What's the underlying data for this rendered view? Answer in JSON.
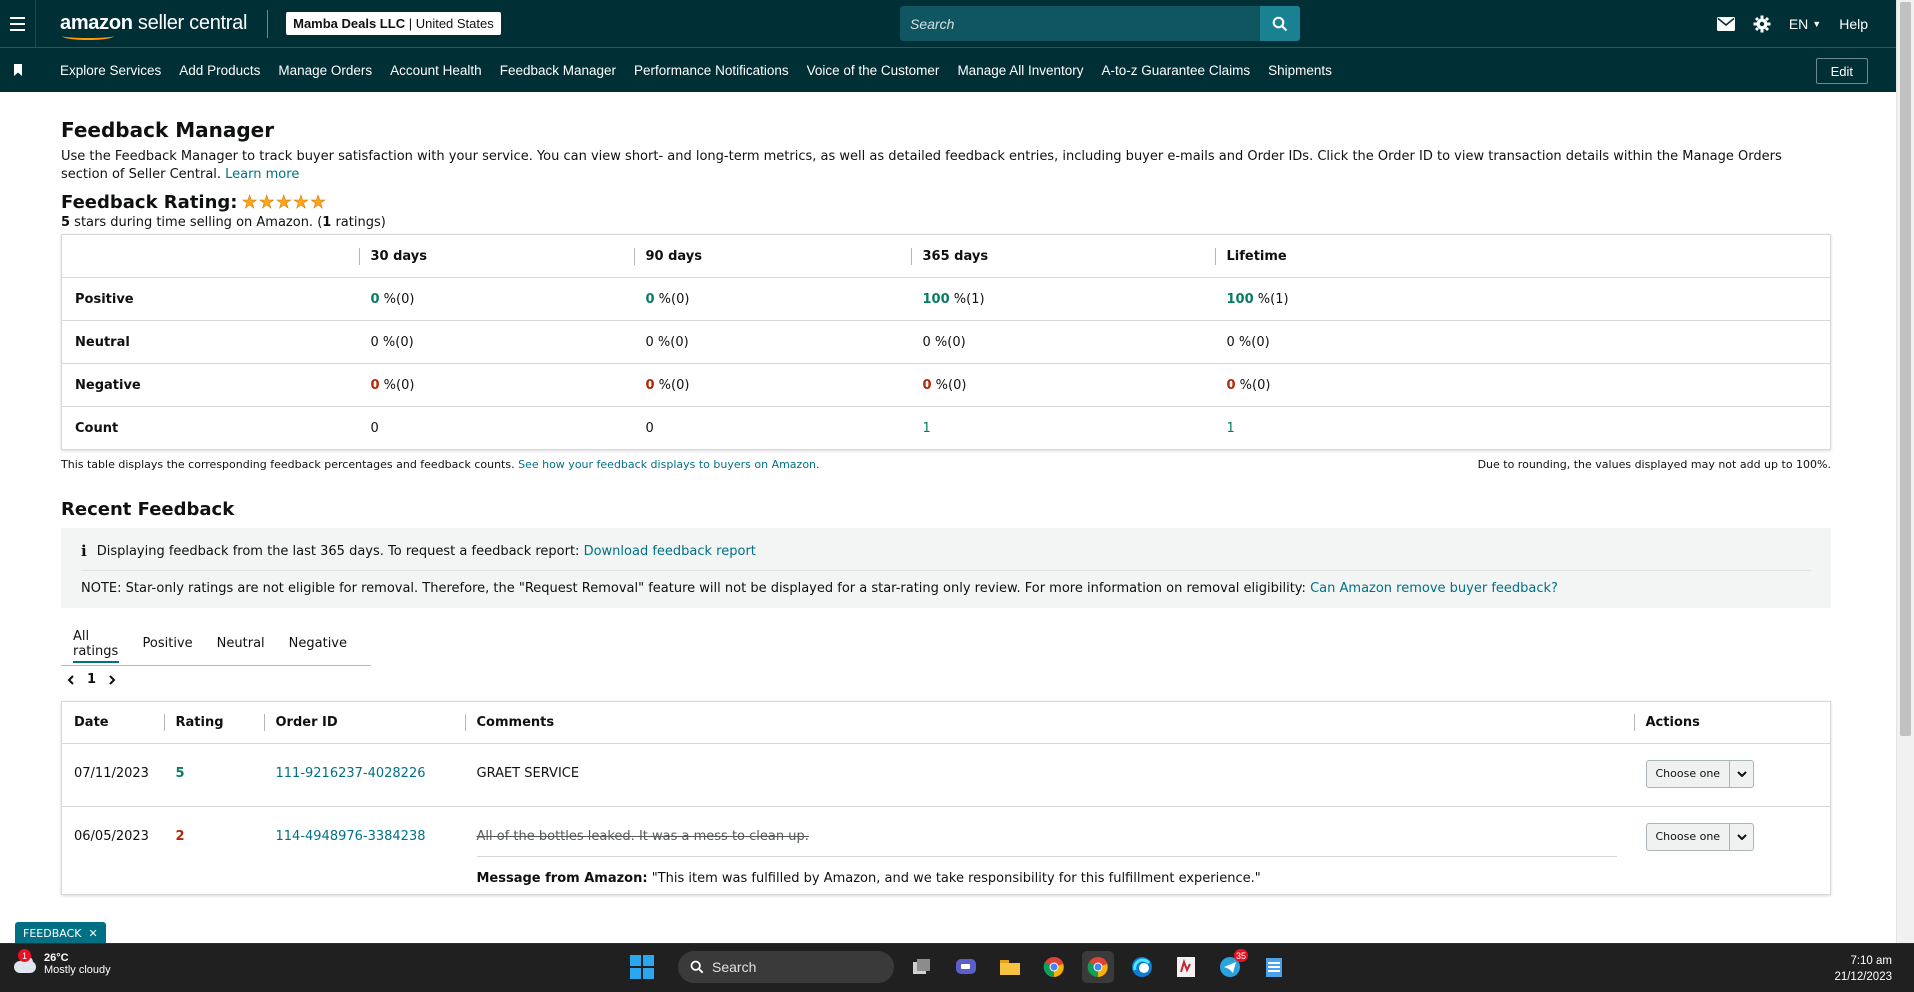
{
  "header": {
    "logo_text_bold": "amazon",
    "logo_text": " seller central",
    "account_name": "Mamba Deals LLC",
    "account_region": " | United States",
    "search_placeholder": "Search",
    "language": "EN",
    "help": "Help"
  },
  "nav": {
    "items": [
      "Explore Services",
      "Add Products",
      "Manage Orders",
      "Account Health",
      "Feedback Manager",
      "Performance Notifications",
      "Voice of the Customer",
      "Manage All Inventory",
      "A-to-z Guarantee Claims",
      "Shipments"
    ],
    "edit_label": "Edit"
  },
  "page": {
    "title": "Feedback Manager",
    "intro": "Use the Feedback Manager to track buyer satisfaction with your service. You can view short- and long-term metrics, as well as detailed feedback entries, including buyer e-mails and Order IDs. Click the Order ID to view transaction details within the Manage Orders section of Seller Central.",
    "learn_more": "Learn more",
    "rating_title": "Feedback Rating:",
    "rating_stars": 5,
    "rating_sub_prefix": "5",
    "rating_sub_middle": " stars during time selling on Amazon. (",
    "rating_sub_count": "1",
    "rating_sub_suffix": " ratings)"
  },
  "summary": {
    "columns": [
      "30 days",
      "90 days",
      "365 days",
      "Lifetime"
    ],
    "rows": {
      "positive": {
        "label": "Positive",
        "cells": [
          [
            "0",
            " %(0)"
          ],
          [
            "0",
            " %(0)"
          ],
          [
            "100",
            " %(1)"
          ],
          [
            "100",
            " %(1)"
          ]
        ]
      },
      "neutral": {
        "label": "Neutral",
        "cells": [
          "0 %(0)",
          "0 %(0)",
          "0 %(0)",
          "0 %(0)"
        ]
      },
      "negative": {
        "label": "Negative",
        "cells": [
          [
            "0",
            " %(0)"
          ],
          [
            "0",
            " %(0)"
          ],
          [
            "0",
            " %(0)"
          ],
          [
            "0",
            " %(0)"
          ]
        ]
      },
      "count": {
        "label": "Count",
        "cells": [
          "0",
          "0",
          "1",
          "1"
        ]
      }
    },
    "note_left": "This table displays the corresponding feedback percentages and feedback counts.",
    "note_link": "See how your feedback displays to buyers on Amazon.",
    "note_right": "Due to rounding, the values displayed may not add up to 100%."
  },
  "recent": {
    "title": "Recent Feedback",
    "info_text": "Displaying feedback from the last 365 days. To request a feedback report:",
    "info_link": "Download feedback report",
    "note_text": "NOTE: Star-only ratings are not eligible for removal. Therefore, the \"Request Removal\" feature will not be displayed for a star-rating only review. For more information on removal eligibility:",
    "note_link": "Can Amazon remove buyer feedback?",
    "tabs": [
      "All ratings",
      "Positive",
      "Neutral",
      "Negative"
    ],
    "page_number": "1",
    "columns": [
      "Date",
      "Rating",
      "Order ID",
      "Comments",
      "Actions"
    ],
    "rows": [
      {
        "date": "07/11/2023",
        "rating": "5",
        "order_id": "111-9216237-4028226",
        "comment": "GRAET SERVICE",
        "action": "Choose one"
      },
      {
        "date": "06/05/2023",
        "rating": "2",
        "order_id": "114-4948976-3384238",
        "comment": "All of the bottles leaked. It was a mess to clean up.",
        "amazon_msg_label": "Message from Amazon:",
        "amazon_msg": " \"This item was fulfilled by Amazon, and we take responsibility for this fulfillment experience.\"",
        "action": "Choose one"
      }
    ]
  },
  "feedback_tab": "FEEDBACK",
  "taskbar": {
    "weather_temp": "26°C",
    "weather_desc": "Mostly cloudy",
    "weather_badge": "1",
    "search": "Search",
    "telegram_badge": "35",
    "time": "7:10 am",
    "date": "21/12/2023"
  },
  "colors": {
    "header_bg": "#002f36",
    "link": "#007185",
    "positive": "#067d62",
    "negative": "#b12704",
    "star": "#ffa41c"
  }
}
